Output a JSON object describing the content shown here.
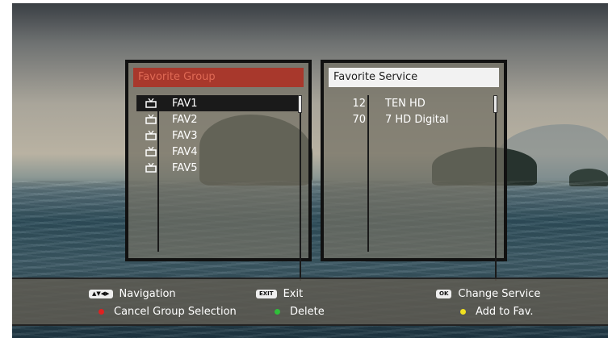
{
  "favorite_group": {
    "title": "Favorite Group",
    "items": [
      {
        "label": "FAV1",
        "icon": "tv-icon",
        "selected": true
      },
      {
        "label": "FAV2",
        "icon": "tv-icon",
        "selected": false
      },
      {
        "label": "FAV3",
        "icon": "tv-icon",
        "selected": false
      },
      {
        "label": "FAV4",
        "icon": "tv-icon",
        "selected": false
      },
      {
        "label": "FAV5",
        "icon": "tv-icon",
        "selected": false
      }
    ]
  },
  "favorite_service": {
    "title": "Favorite Service",
    "services": [
      {
        "number": "12",
        "name": "TEN HD"
      },
      {
        "number": "70",
        "name": "7 HD Digital"
      }
    ]
  },
  "footer": {
    "navigation": {
      "key": "▲▼◀▶",
      "label": "Navigation"
    },
    "exit": {
      "key": "EXIT",
      "label": "Exit"
    },
    "ok": {
      "key": "OK",
      "label": "Change Service"
    },
    "red": {
      "color": "#e02020",
      "label": "Cancel Group Selection"
    },
    "green": {
      "color": "#2fbf3a",
      "label": "Delete"
    },
    "yellow": {
      "color": "#f0e020",
      "label": "Add to Fav."
    }
  }
}
